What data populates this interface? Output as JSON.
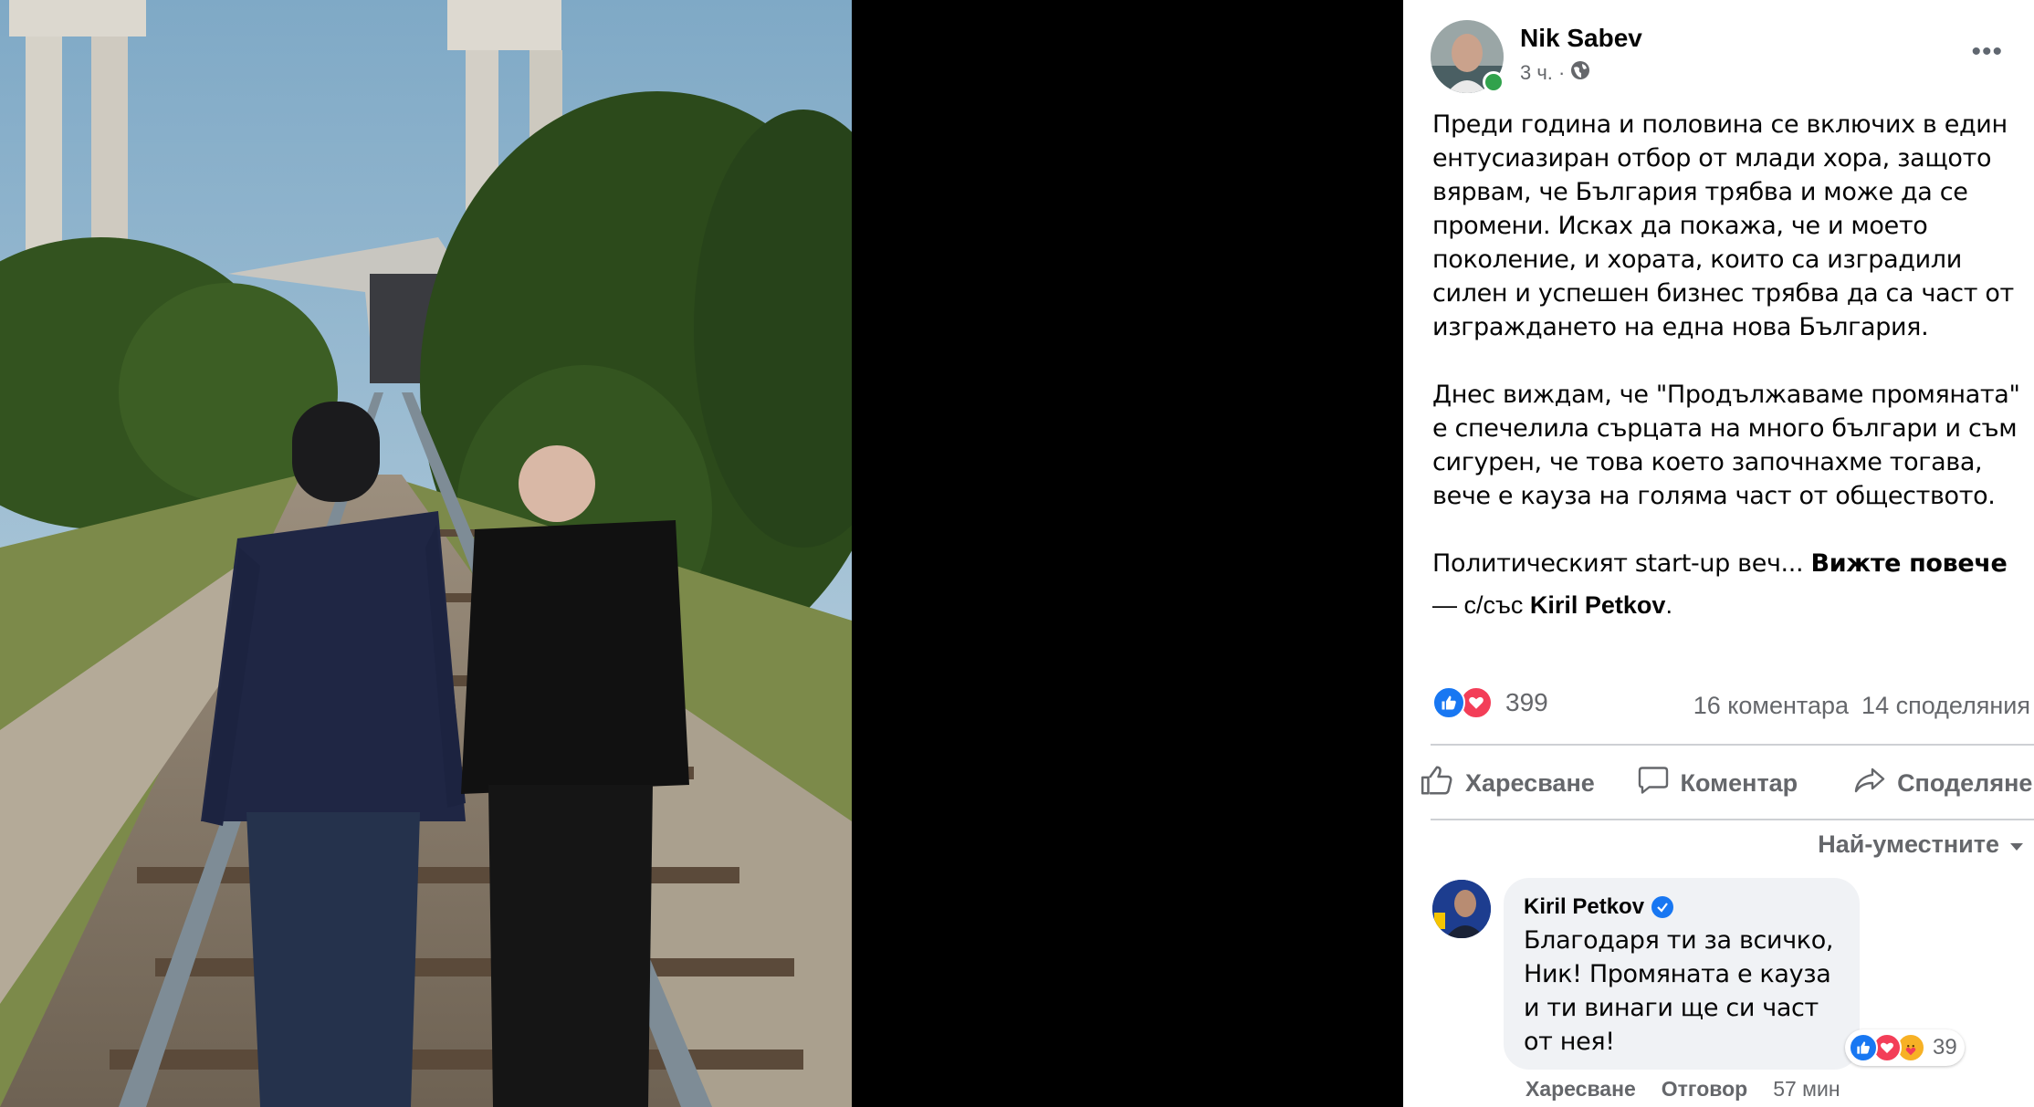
{
  "post": {
    "author": "Nik Sabev",
    "time": "3 ч. ·",
    "paragraph1": "Преди година и половина се включих в един ентусиазиран отбор от млади хора, защото вярвам, че България трябва и може да се промени. Исках да покажа, че и моето поколение, и хората, които са изградили силен и успешен бизнес трябва да са част от изграждането на една нова България.",
    "paragraph2": "Днес виждам, че \"Продължаваме промяната\" е спечелила сърцата на много българи и съм сигурен, че това което започнахме тогава, вече е кауза на голяма част от обществото.",
    "paragraph3_start": "Политическият start-up веч... ",
    "see_more": "Вижте повече",
    "tag_prefix": "— с/със ",
    "tag_name": "Kiril Petkov",
    "tag_suffix": "."
  },
  "stats": {
    "reactions": "399",
    "comments": "16 коментара",
    "shares": "14 споделяния"
  },
  "actions": {
    "like": "Харесване",
    "comment": "Коментар",
    "share": "Споделяне"
  },
  "sort": {
    "label": "Най-уместните"
  },
  "comment": {
    "author": "Kiril Petkov",
    "text": "Благодаря ти за всичко, Ник! Промяната е кауза и ти винаги ще си част от нея!",
    "reactions": "39",
    "like": "Харесване",
    "reply": "Отговор",
    "time": "57 мин"
  },
  "colors": {
    "accent": "#1877f2",
    "love": "#f33e58",
    "online": "#31a24c",
    "secondary_text": "#65676b"
  },
  "icons": [
    "globe-icon",
    "more-icon",
    "like-reaction-icon",
    "love-reaction-icon",
    "care-reaction-icon",
    "thumbs-up-icon",
    "comment-icon",
    "share-icon",
    "chevron-down-icon",
    "verified-icon"
  ]
}
